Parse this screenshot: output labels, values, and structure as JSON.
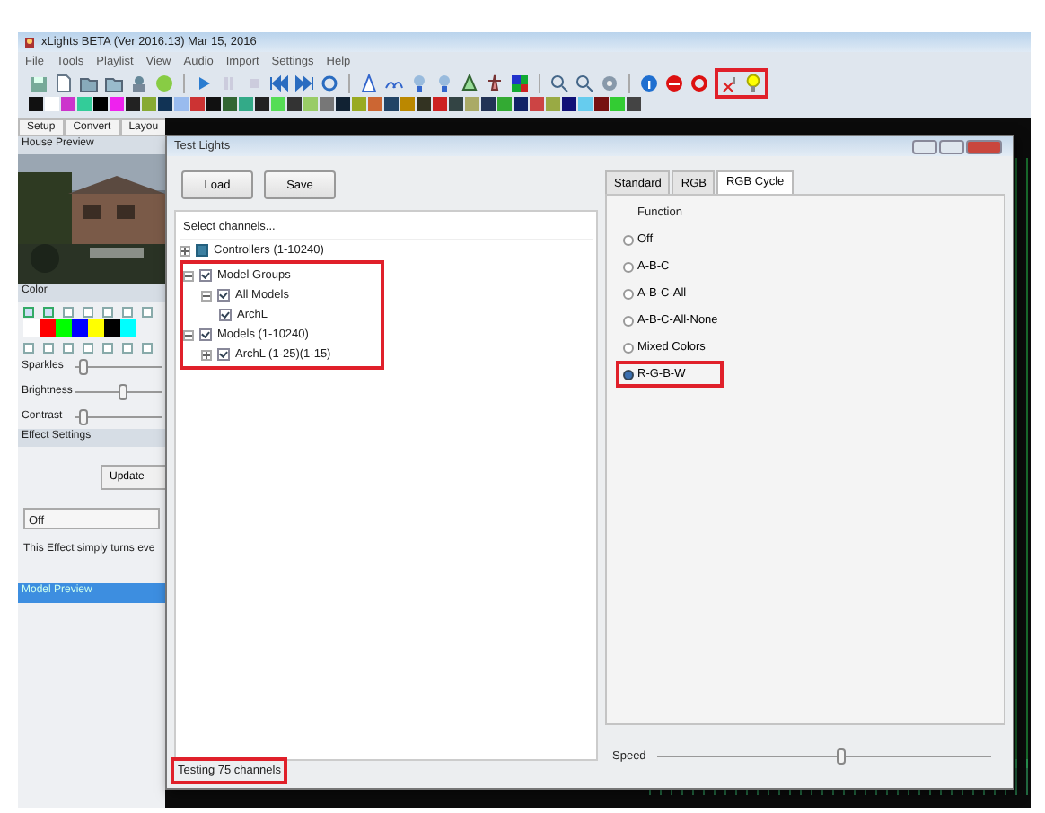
{
  "window": {
    "title": "xLights BETA (Ver 2016.13) Mar 15, 2016"
  },
  "menu": [
    "File",
    "Tools",
    "Playlist",
    "View",
    "Audio",
    "Import",
    "Settings",
    "Help"
  ],
  "toolbar": {
    "test_icons_highlighted": true
  },
  "tabs": [
    "Setup",
    "Convert",
    "Layou"
  ],
  "house_preview": {
    "title": "House Preview"
  },
  "color_panel": {
    "title": "Color",
    "swatches": [
      {
        "color": "#ffffff",
        "checked": true,
        "locked": false
      },
      {
        "color": "#ff0000",
        "checked": true,
        "locked": false
      },
      {
        "color": "#00ff00",
        "checked": false,
        "locked": false
      },
      {
        "color": "#0000ff",
        "checked": false,
        "locked": false
      },
      {
        "color": "#ffff00",
        "checked": false,
        "locked": false
      },
      {
        "color": "#000000",
        "checked": false,
        "locked": false
      },
      {
        "color": "#00ffff",
        "checked": false,
        "locked": false
      }
    ]
  },
  "sliders": [
    {
      "label": "Sparkles",
      "level": 0.08
    },
    {
      "label": "Brightness",
      "level": 0.55
    },
    {
      "label": "Contrast",
      "level": 0.08
    }
  ],
  "effect_settings": {
    "title": "Effect Settings",
    "button": "Update",
    "dropdown": "Off",
    "description": "This Effect simply turns eve"
  },
  "model_preview": {
    "title": "Model Preview"
  },
  "dialog": {
    "title": "Test Lights",
    "buttons": [
      "Load",
      "Save"
    ],
    "tree_header": "Select channels...",
    "tree": [
      {
        "label": "Controllers (1-10240)",
        "checked": false,
        "partial": true,
        "expanded": false,
        "highlighted": false
      },
      {
        "label": "Model Groups",
        "checked": true,
        "expanded": true,
        "highlighted": true,
        "children": [
          {
            "label": "All Models",
            "checked": true,
            "expanded": true,
            "children": [
              {
                "label": "ArchL",
                "checked": true
              }
            ]
          }
        ]
      },
      {
        "label": "Models (1-10240)",
        "checked": true,
        "expanded": true,
        "highlighted": true,
        "children": [
          {
            "label": "ArchL (1-25)(1-15)",
            "checked": true,
            "expanded": false
          }
        ]
      }
    ],
    "status": {
      "text": "Testing 75 channels",
      "highlighted": true
    },
    "tabs": [
      {
        "label": "Standard",
        "selected": false
      },
      {
        "label": "RGB",
        "selected": false
      },
      {
        "label": "RGB Cycle",
        "selected": true
      }
    ],
    "function_label": "Function",
    "radios": [
      {
        "label": "Off",
        "selected": false,
        "highlighted": false
      },
      {
        "label": "A-B-C",
        "selected": false,
        "highlighted": false
      },
      {
        "label": "A-B-C-All",
        "selected": false,
        "highlighted": false
      },
      {
        "label": "A-B-C-All-None",
        "selected": false,
        "highlighted": false
      },
      {
        "label": "Mixed Colors",
        "selected": false,
        "highlighted": false
      },
      {
        "label": "R-G-B-W",
        "selected": true,
        "highlighted": true
      }
    ],
    "speed": {
      "label": "Speed",
      "level": 0.55
    }
  }
}
